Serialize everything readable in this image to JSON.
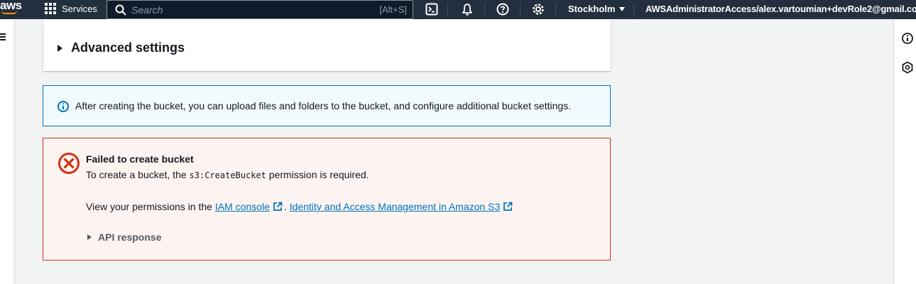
{
  "topnav": {
    "logo_text": "aws",
    "services_label": "Services",
    "search_placeholder": "Search",
    "search_shortcut": "[Alt+S]",
    "region": "Stockholm",
    "account": "AWSAdministratorAccess/alex.vartoumian+devRole2@gmail.com",
    "icons": [
      "cloudshell-icon",
      "notifications-bell-icon",
      "help-icon",
      "settings-gear-icon"
    ]
  },
  "advanced": {
    "title": "Advanced settings"
  },
  "info": {
    "text": "After creating the bucket, you can upload files and folders to the bucket, and configure additional bucket settings."
  },
  "error": {
    "title": "Failed to create bucket",
    "msg_prefix": "To create a bucket, the ",
    "msg_code": "s3:CreateBucket",
    "msg_suffix": " permission is required.",
    "perm_prefix": "View your permissions in the ",
    "link_iam": "IAM console",
    "separator": ".",
    "link_iam_s3": "Identity and Access Management in Amazon S3",
    "api_response_label": "API response"
  },
  "colors": {
    "nav_bg": "#232f3e",
    "info_border": "#0073bb",
    "error_border": "#d13212",
    "link": "#0073bb"
  }
}
